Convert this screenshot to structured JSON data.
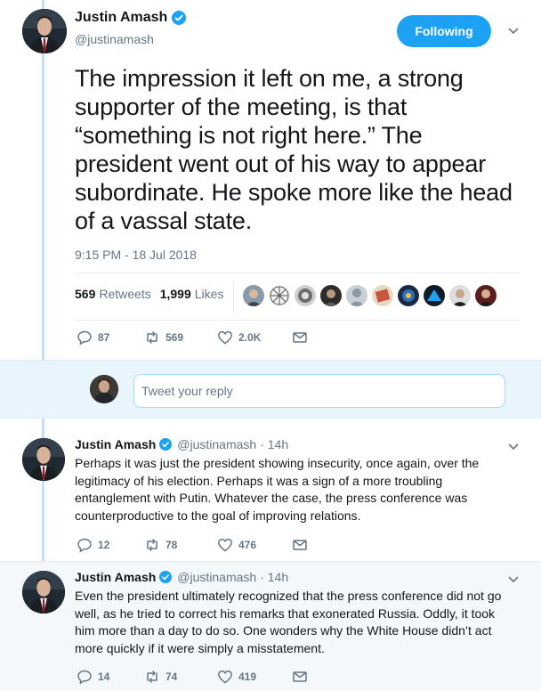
{
  "colors": {
    "accent": "#1da1f2",
    "verified": "#1da1f2",
    "thread_line": "#bfe3f4",
    "muted": "#657786"
  },
  "main_tweet": {
    "display_name": "Justin Amash",
    "handle": "@justinamash",
    "follow_label": "Following",
    "text": "The impression it left on me, a strong supporter of the meeting, is that “something is not right here.” The president went out of his way to appear subordinate. He spoke more like the head of a vassal state.",
    "timestamp": "9:15 PM - 18 Jul 2018",
    "retweets_count": "569",
    "retweets_label": "Retweets",
    "likes_count": "1,999",
    "likes_label": "Likes",
    "liker_avatar_count": 10,
    "actions": {
      "replies": "87",
      "retweets": "569",
      "likes": "2.0K"
    },
    "icons": [
      "verified-icon",
      "chevron-down-icon",
      "reply-icon",
      "retweet-icon",
      "heart-icon",
      "mail-icon"
    ]
  },
  "reply_composer": {
    "placeholder": "Tweet your reply"
  },
  "replies": [
    {
      "display_name": "Justin Amash",
      "handle": "@justinamash",
      "time": "· 14h",
      "text": "Perhaps it was just the president showing insecurity, once again, over the legitimacy of his election. Perhaps it was a sign of a more troubling entanglement with Putin. Whatever the case, the press conference was counterproductive to the goal of improving relations.",
      "replies": "12",
      "retweets": "78",
      "likes": "476"
    },
    {
      "display_name": "Justin Amash",
      "handle": "@justinamash",
      "time": "· 14h",
      "text": "Even the president ultimately recognized that the press conference did not go well, as he tried to correct his remarks that exonerated Russia. Oddly, it took him more than a day to do so. One wonders why the White House didn’t act more quickly if it were simply a misstatement.",
      "replies": "14",
      "retweets": "74",
      "likes": "419"
    }
  ]
}
